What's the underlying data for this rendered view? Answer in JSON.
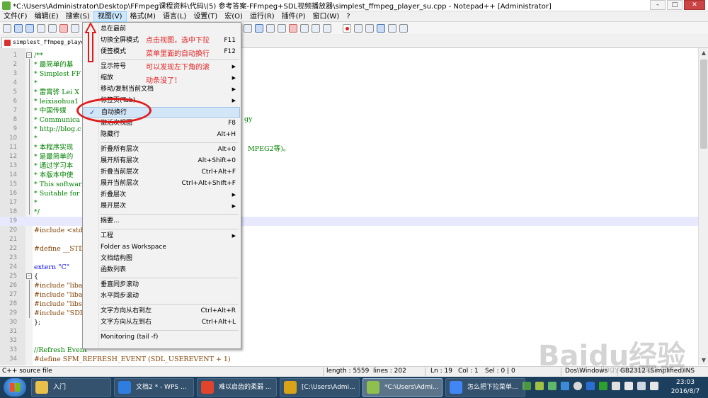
{
  "window": {
    "title": "*C:\\Users\\Administrator\\Desktop\\FFmpeg课程资料\\代码\\(5) 参考答案-FFmpeg+SDL视频播放器\\simplest_ffmpeg_player_su.cpp - Notepad++ [Administrator]"
  },
  "menubar": [
    "文件(F)",
    "编辑(E)",
    "搜索(S)",
    "视图(V)",
    "格式(M)",
    "语言(L)",
    "设置(T)",
    "宏(O)",
    "运行(R)",
    "插件(P)",
    "窗口(W)",
    "?"
  ],
  "menubar_active": "视图(V)",
  "tab": {
    "name": "simplest_ffmpeg_player"
  },
  "editor": {
    "lines": [
      {
        "n": "1",
        "code": "/**",
        "cls": "c-comment"
      },
      {
        "n": "2",
        "code": " * 最简单的基",
        "cls": "c-comment"
      },
      {
        "n": "3",
        "code": " * Simplest FF",
        "cls": "c-comment"
      },
      {
        "n": "4",
        "code": " *",
        "cls": "c-comment"
      },
      {
        "n": "5",
        "code": " * 雷霄骅 Lei X",
        "cls": "c-comment"
      },
      {
        "n": "6",
        "code": " * leixiaohua1",
        "cls": "c-comment"
      },
      {
        "n": "7",
        "code": " * 中国传媒",
        "cls": "c-comment"
      },
      {
        "n": "8",
        "code": " * Communica",
        "cls": "c-comment"
      },
      {
        "n": "9",
        "code": " * http://blog.c",
        "cls": "c-comment"
      },
      {
        "n": "10",
        "code": " *",
        "cls": "c-comment"
      },
      {
        "n": "11",
        "code": " * 本程序实现",
        "cls": "c-comment"
      },
      {
        "n": "12",
        "code": " * 是最简单的",
        "cls": "c-comment"
      },
      {
        "n": "13",
        "code": " * 通过学习本",
        "cls": "c-comment"
      },
      {
        "n": "14",
        "code": " * 本版本中使",
        "cls": "c-comment"
      },
      {
        "n": "15",
        "code": " * This softwar",
        "cls": "c-comment"
      },
      {
        "n": "16",
        "code": " * Suitable for",
        "cls": "c-comment"
      },
      {
        "n": "17",
        "code": " *",
        "cls": "c-comment"
      },
      {
        "n": "18",
        "code": " */",
        "cls": "c-comment"
      },
      {
        "n": "19",
        "code": "",
        "cls": "c-text"
      },
      {
        "n": "20",
        "code": "#include <stdi",
        "cls": "c-pre"
      },
      {
        "n": "21",
        "code": "",
        "cls": "c-text"
      },
      {
        "n": "22",
        "code": "#define __STD",
        "cls": "c-pre"
      },
      {
        "n": "23",
        "code": "",
        "cls": "c-text"
      },
      {
        "n": "24",
        "code": "extern \"C\"",
        "cls": "c-kw"
      },
      {
        "n": "25",
        "code": "{",
        "cls": "c-text"
      },
      {
        "n": "26",
        "code": "#include \"libav",
        "cls": "c-pre"
      },
      {
        "n": "27",
        "code": "#include \"libav",
        "cls": "c-pre"
      },
      {
        "n": "28",
        "code": "#include \"libsv",
        "cls": "c-pre"
      },
      {
        "n": "29",
        "code": "#include \"SDL",
        "cls": "c-pre"
      },
      {
        "n": "30",
        "code": "};",
        "cls": "c-text"
      },
      {
        "n": "31",
        "code": "",
        "cls": "c-text"
      },
      {
        "n": "32",
        "code": "",
        "cls": "c-text"
      },
      {
        "n": "33",
        "code": "//Refresh Event",
        "cls": "c-comment"
      },
      {
        "n": "34",
        "code": "#define SFM_REFRESH_EVENT  (SDL_USEREVENT + 1)",
        "cls": "c-pre"
      }
    ],
    "peek_line8": "gy",
    "peek_line11": "MPEG2等)。",
    "current_line": "19"
  },
  "view_menu": {
    "items": [
      {
        "label": "总在最前",
        "shortcut": ""
      },
      {
        "label": "切换全屏模式",
        "shortcut": "F11"
      },
      {
        "label": "便签模式",
        "shortcut": "F12"
      },
      {
        "sep": true
      },
      {
        "label": "显示符号",
        "submenu": true
      },
      {
        "label": "缩放",
        "submenu": true
      },
      {
        "label": "移动/复制当前文档",
        "submenu": true
      },
      {
        "label": "标签页(Tab)",
        "submenu": true
      },
      {
        "label": "自动换行",
        "checked": true,
        "highlight": true
      },
      {
        "label": "激活次视图",
        "shortcut": "F8"
      },
      {
        "label": "隐藏行",
        "shortcut": "Alt+H"
      },
      {
        "sep": true
      },
      {
        "label": "折叠所有层次",
        "shortcut": "Alt+0"
      },
      {
        "label": "展开所有层次",
        "shortcut": "Alt+Shift+0"
      },
      {
        "label": "折叠当前层次",
        "shortcut": "Ctrl+Alt+F"
      },
      {
        "label": "展开当前层次",
        "shortcut": "Ctrl+Alt+Shift+F"
      },
      {
        "label": "折叠层次",
        "submenu": true
      },
      {
        "label": "展开层次",
        "submenu": true
      },
      {
        "sep": true
      },
      {
        "label": "摘要...",
        "shortcut": ""
      },
      {
        "sep": true
      },
      {
        "label": "工程",
        "submenu": true
      },
      {
        "label": "Folder as Workspace",
        "shortcut": ""
      },
      {
        "label": "文档结构图",
        "shortcut": ""
      },
      {
        "label": "函数列表",
        "shortcut": ""
      },
      {
        "sep": true
      },
      {
        "label": "垂直同步滚动",
        "shortcut": ""
      },
      {
        "label": "水平同步滚动",
        "shortcut": ""
      },
      {
        "sep": true
      },
      {
        "label": "文字方向从右到左",
        "shortcut": "Ctrl+Alt+R"
      },
      {
        "label": "文字方向从左到右",
        "shortcut": "Ctrl+Alt+L"
      },
      {
        "sep": true
      },
      {
        "label": "Monitoring (tail -f)",
        "shortcut": ""
      }
    ]
  },
  "annotations": {
    "line1": "点击视图，选中下拉",
    "line2": "菜单里面的自动换行",
    "line3": "可以发现左下角的滚",
    "line4": "动条没了！"
  },
  "statusbar": {
    "file_type": "C++ source file",
    "length": "length : 5559",
    "lines": "lines : 202",
    "ln": "Ln : 19",
    "col": "Col : 1",
    "sel": "Sel : 0 | 0",
    "eol": "Dos\\Windows",
    "encoding": "GB2312 (Simplified)",
    "mode": "INS"
  },
  "taskbar": {
    "tasks": [
      {
        "label": "入门",
        "color": "#e8c04a"
      },
      {
        "label": "文档2 * - WPS ...",
        "color": "#2f7de1"
      },
      {
        "label": "难以启齿的柔弱 ...",
        "color": "#e0442c"
      },
      {
        "label": "[C:\\Users\\Admi...",
        "color": "#d8a316"
      },
      {
        "label": "*C:\\Users\\Admi...",
        "color": "#8fbf4f"
      },
      {
        "label": "怎么把下拉菜单...",
        "color": "#4285f4"
      }
    ],
    "active_index": 4,
    "time": "23:03",
    "date": "2016/8/7"
  },
  "watermark": {
    "logo": "Baidu经验",
    "sub": "jingyan.baidu.com"
  },
  "colors": {
    "annotation": "#e02020",
    "menu_highlight": "#d3e6f8",
    "current_line": "#e8e8ff"
  }
}
